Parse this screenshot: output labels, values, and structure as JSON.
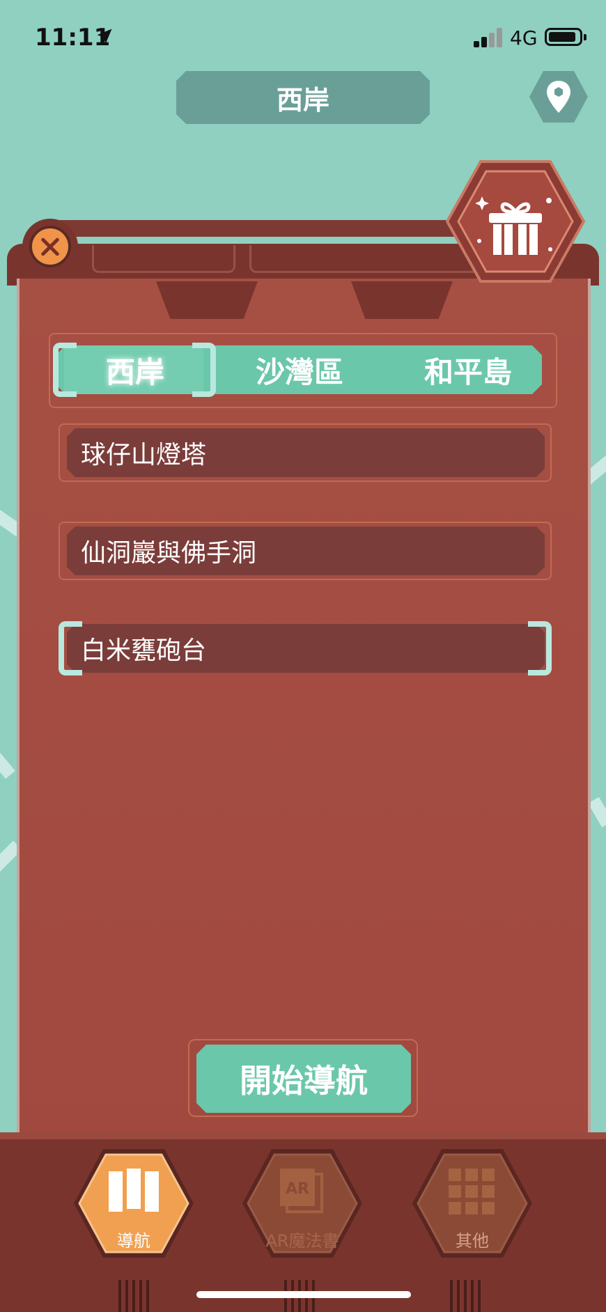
{
  "status_bar": {
    "time": "11:11",
    "network": "4G"
  },
  "header": {
    "title": "西岸"
  },
  "tabs": [
    {
      "label": "西岸",
      "active": true
    },
    {
      "label": "沙灣區",
      "active": false
    },
    {
      "label": "和平島",
      "active": false
    }
  ],
  "locations": [
    {
      "label": "球仔山燈塔",
      "selected": false
    },
    {
      "label": "仙洞巖與佛手洞",
      "selected": false
    },
    {
      "label": "白米甕砲台",
      "selected": true
    }
  ],
  "start_button": {
    "label": "開始導航"
  },
  "bottom_nav": [
    {
      "label": "導航",
      "icon": "map-icon",
      "active": true
    },
    {
      "label": "AR魔法書",
      "icon": "ar-book-icon",
      "active": false
    },
    {
      "label": "其他",
      "icon": "grid-icon",
      "active": false
    }
  ],
  "colors": {
    "background": "#8fd0c1",
    "panel": "#a64f43",
    "accent_green": "#6bc7aa",
    "accent_orange": "#f0944a"
  }
}
